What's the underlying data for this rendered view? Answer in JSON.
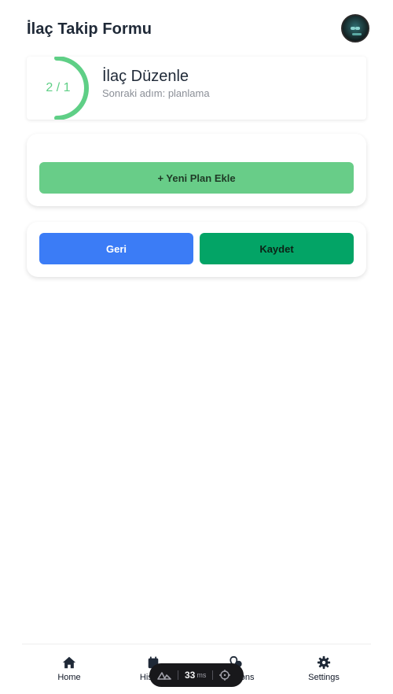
{
  "header": {
    "title": "İlaç Takip Formu"
  },
  "progress": {
    "label": "2 / 1",
    "current": 2,
    "total": 1,
    "accent": "#5fcf86"
  },
  "step": {
    "title": "İlaç Düzenle",
    "next": "Sonraki adım: planlama"
  },
  "plan": {
    "add_label": "+ Yeni Plan Ekle"
  },
  "actions": {
    "back_label": "Geri",
    "save_label": "Kaydet"
  },
  "nav": {
    "items": [
      {
        "label": "Home",
        "icon": "home-icon"
      },
      {
        "label": "History",
        "icon": "calendar-icon"
      },
      {
        "label": "Locations",
        "icon": "location-icon"
      },
      {
        "label": "Settings",
        "icon": "gear-icon"
      }
    ]
  },
  "devtools": {
    "value": "33",
    "unit": "ms"
  },
  "colors": {
    "primary_blue": "#3b7cf6",
    "save_green": "#03a466",
    "add_green": "#68cd88"
  }
}
